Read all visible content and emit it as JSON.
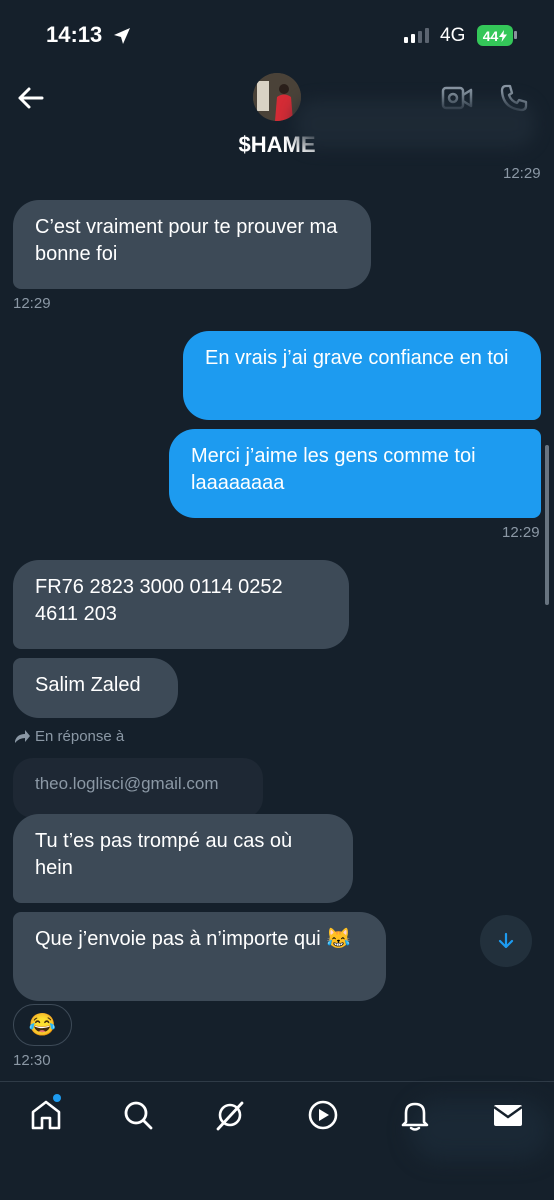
{
  "status_bar": {
    "time": "14:13",
    "network": "4G",
    "battery": "44"
  },
  "header": {
    "contact_name": "$HAME"
  },
  "messages": {
    "ts_top": "12:29",
    "m1": "C’est vraiment pour te prouver ma bonne foi",
    "ts_m1": "12:29",
    "m2": "En vrais j’ai grave confiance en toi",
    "m3": "Merci j’aime les gens comme toi laaaaaaaa",
    "ts_m3": "12:29",
    "m4": "FR76 2823 3000 0114 0252 4611 203",
    "m5": "Salim Zaled",
    "reply_label": "En réponse à",
    "quoted_text": "theo.loglisci@gmail.com",
    "m6": "Tu t’es pas trompé au cas où hein",
    "m7": "Que j’envoie pas à n’importe qui 😹",
    "reaction": "😂",
    "ts_last": "12:30"
  },
  "colors": {
    "background": "#15202b",
    "incoming_bubble": "#3d4a57",
    "outgoing_bubble": "#1d9bf0",
    "muted_text": "#8b98a5"
  },
  "tabs": [
    "home-icon",
    "search-icon",
    "grok-icon",
    "video-icon",
    "notifications-icon",
    "messages-icon"
  ]
}
